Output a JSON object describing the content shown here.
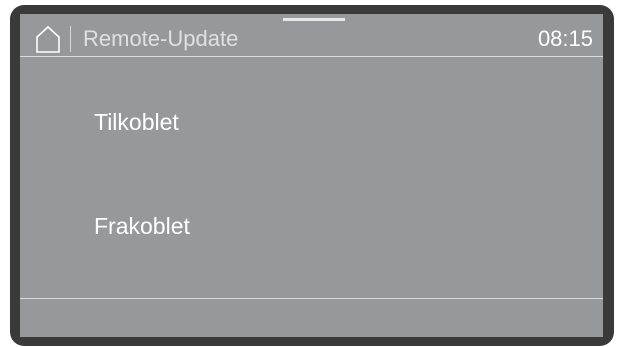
{
  "header": {
    "home_icon": "home-icon",
    "title": "Remote-Update",
    "time": "08:15"
  },
  "options": [
    {
      "label": "Tilkoblet"
    },
    {
      "label": "Frakoblet"
    }
  ],
  "colors": {
    "bezel": "#3a3a3b",
    "screen": "#97989c",
    "text": "#ffffff",
    "title_text": "#dfe0e2",
    "divider": "#d9dadc"
  }
}
